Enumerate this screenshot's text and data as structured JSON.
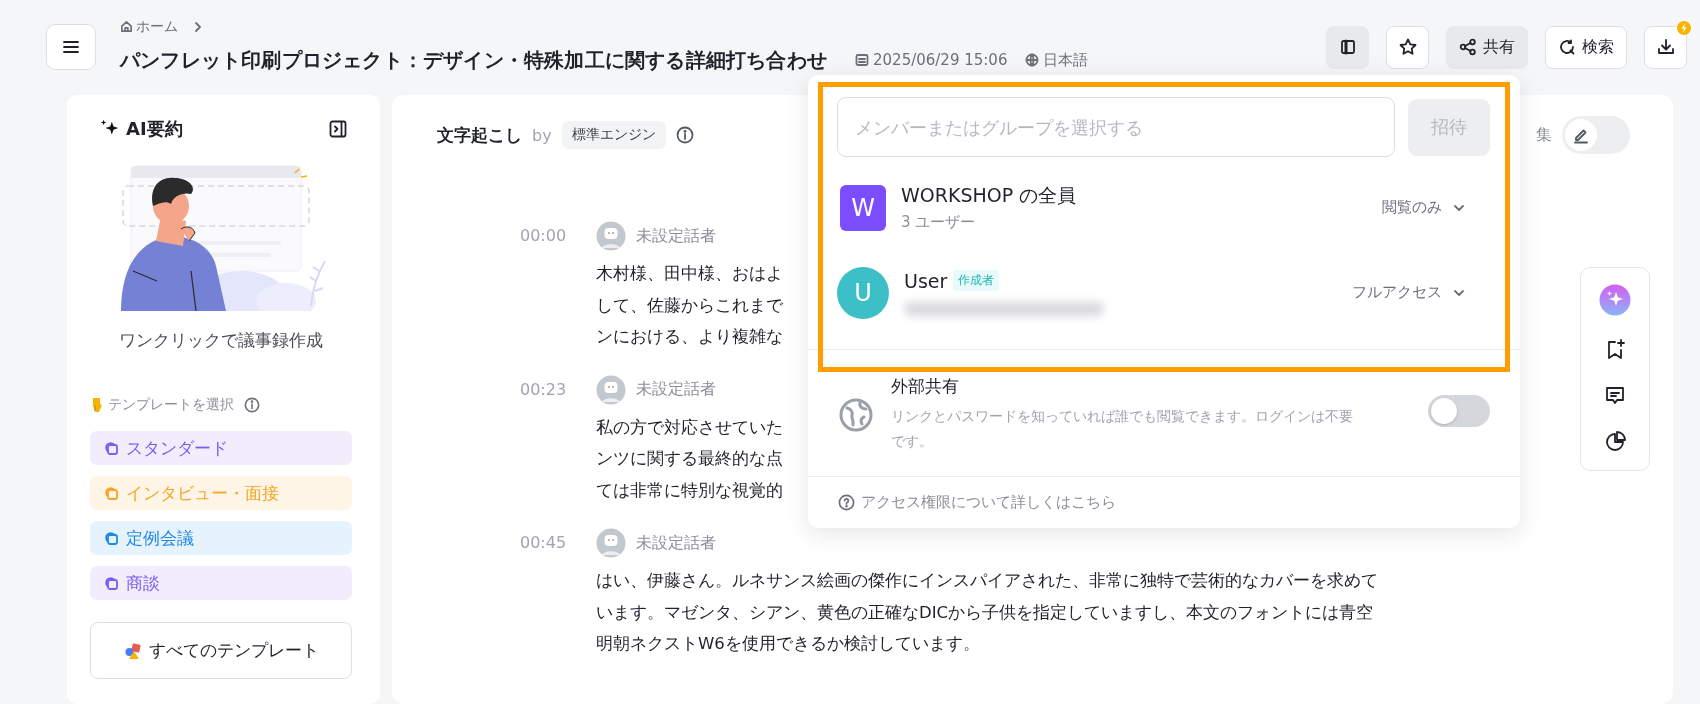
{
  "header": {
    "breadcrumb": [
      {
        "label": "ホーム"
      }
    ],
    "title": "パンフレット印刷プロジェクト：デザイン・特殊加工に関する詳細打ち合わせ",
    "date": "2025/06/29 15:06",
    "language": "日本語",
    "actions": [
      {
        "kind": "panel",
        "selected": true
      },
      {
        "kind": "star",
        "selected": false
      },
      {
        "kind": "share",
        "label": "共有",
        "selected": true
      },
      {
        "kind": "search",
        "label": "検索",
        "selected": false
      },
      {
        "kind": "download",
        "selected": false
      }
    ]
  },
  "summary_panel": {
    "title": "AI要約",
    "caption": "ワンクリックで議事録作成",
    "template_prompt": "テンプレートを選択",
    "templates": [
      {
        "label": "スタンダード",
        "color": "#7b5cf0"
      },
      {
        "label": "インタビュー・面接",
        "color": "#f5a623"
      },
      {
        "label": "定例会議",
        "color": "#1e88e5"
      },
      {
        "label": "商談",
        "color": "#7b5cf0"
      }
    ],
    "all_templates_button": "すべてのテンプレート"
  },
  "transcript": {
    "title": "文字起こし",
    "by": "by",
    "engine": "標準エンジン",
    "edit_label": "集",
    "edit_toggle": {
      "on": false
    },
    "segments": [
      {
        "time": "00:00",
        "speaker": "未設定話者",
        "lines": [
          "木村様、田中様、おはよ",
          "して、佐藤からこれまで",
          "ンにおける、より複雑な"
        ]
      },
      {
        "time": "00:23",
        "speaker": "未設定話者",
        "lines": [
          "私の方で対応させていた",
          "ンツに関する最終的な点",
          "ては非常に特別な視覚的"
        ]
      },
      {
        "time": "00:45",
        "speaker": "未設定話者",
        "lines": [
          "はい、伊藤さん。ルネサンス絵画の傑作にインスパイアされた、非常に独特で芸術的なカバーを求めて",
          "います。マゼンタ、シアン、黄色の正確なDICから子供を指定していますし、本文のフォントには青空",
          "明朝ネクストW6を使用できるか検討しています。"
        ]
      }
    ]
  },
  "share_popup": {
    "search_placeholder": "メンバーまたはグループを選択する",
    "invite_button": {
      "label": "招待",
      "disabled": true
    },
    "members": [
      {
        "kind": "group",
        "initial": "W",
        "name": "WORKSHOP の全員",
        "detail": "3 ユーザー",
        "permission": "閲覧のみ",
        "color": "#7c4dff"
      },
      {
        "kind": "user",
        "initial": "U",
        "name": "User",
        "badge": "作成者",
        "permission": "フルアクセス",
        "color": "#3cbfc6"
      }
    ],
    "external_share": {
      "title": "外部共有",
      "description": "リンクとパスワードを知っていれば誰でも閲覧できます。ログインは不要です。",
      "on": false
    },
    "help_link": "アクセス権限について詳しくはこちら"
  }
}
